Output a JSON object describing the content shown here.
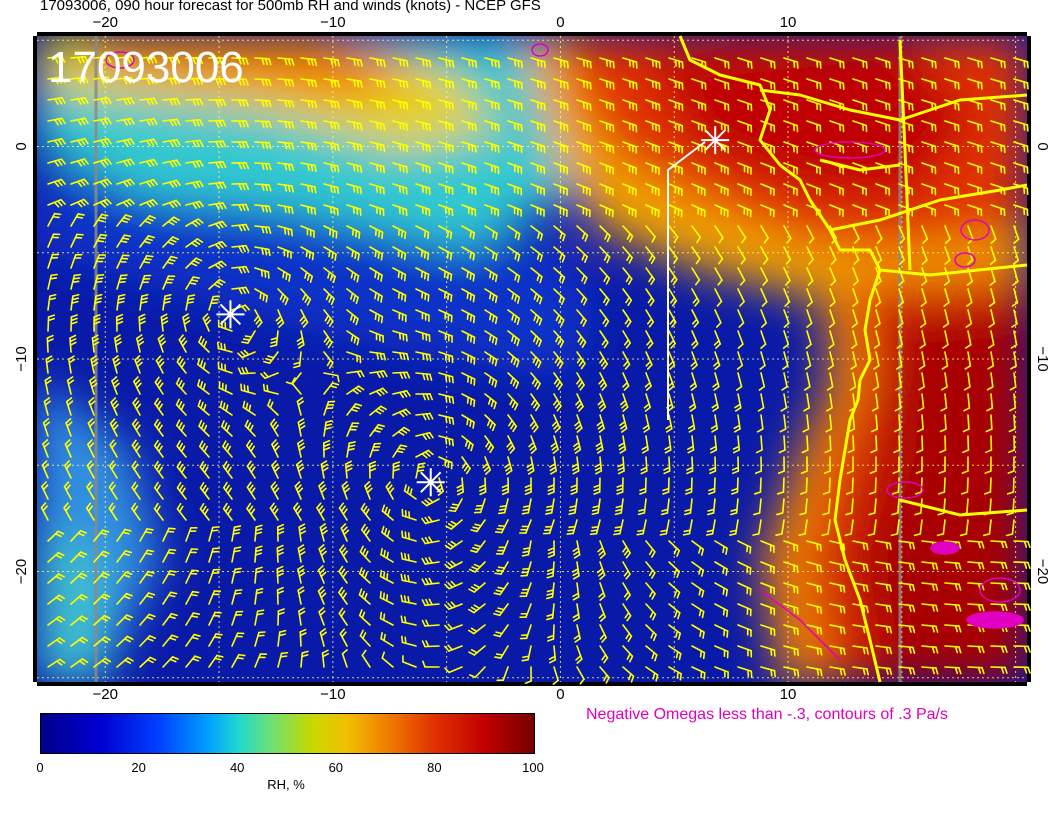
{
  "title": "17093006, 090 hour forecast for 500mb RH and winds (knots) - NCEP GFS",
  "map_stamp": "17093006",
  "legend": {
    "omega_note": "Negative Omegas less than -.3, contours of .3 Pa/s",
    "colorbar_label": "RH, %",
    "colorbar_ticks": [
      "0",
      "20",
      "40",
      "60",
      "80",
      "100"
    ]
  },
  "axes": {
    "x_top_ticks": [
      "−20",
      "−10",
      "0",
      "10"
    ],
    "x_bottom_ticks": [
      "−20",
      "−10",
      "0",
      "10"
    ],
    "y_left_ticks": [
      "0",
      "−10",
      "−20"
    ],
    "y_right_ticks": [
      "0",
      "−10",
      "−20"
    ],
    "lon_range": [
      -23,
      20.5
    ],
    "lat_range": [
      5.2,
      -25.2
    ]
  },
  "markers": [
    {
      "name": "storm-marker-1",
      "lon": -14.5,
      "lat": -7.9
    },
    {
      "name": "storm-marker-2",
      "lon": -5.7,
      "lat": -15.8
    },
    {
      "name": "storm-marker-3",
      "lon": 6.8,
      "lat": 0.3
    }
  ],
  "colors": {
    "coastline": "#ffff00",
    "wind_barb": "#ffff00",
    "omega_contour": "#e000c0",
    "marker": "#ffffff",
    "rh_low": "#00008c",
    "rh_high": "#780000"
  }
}
